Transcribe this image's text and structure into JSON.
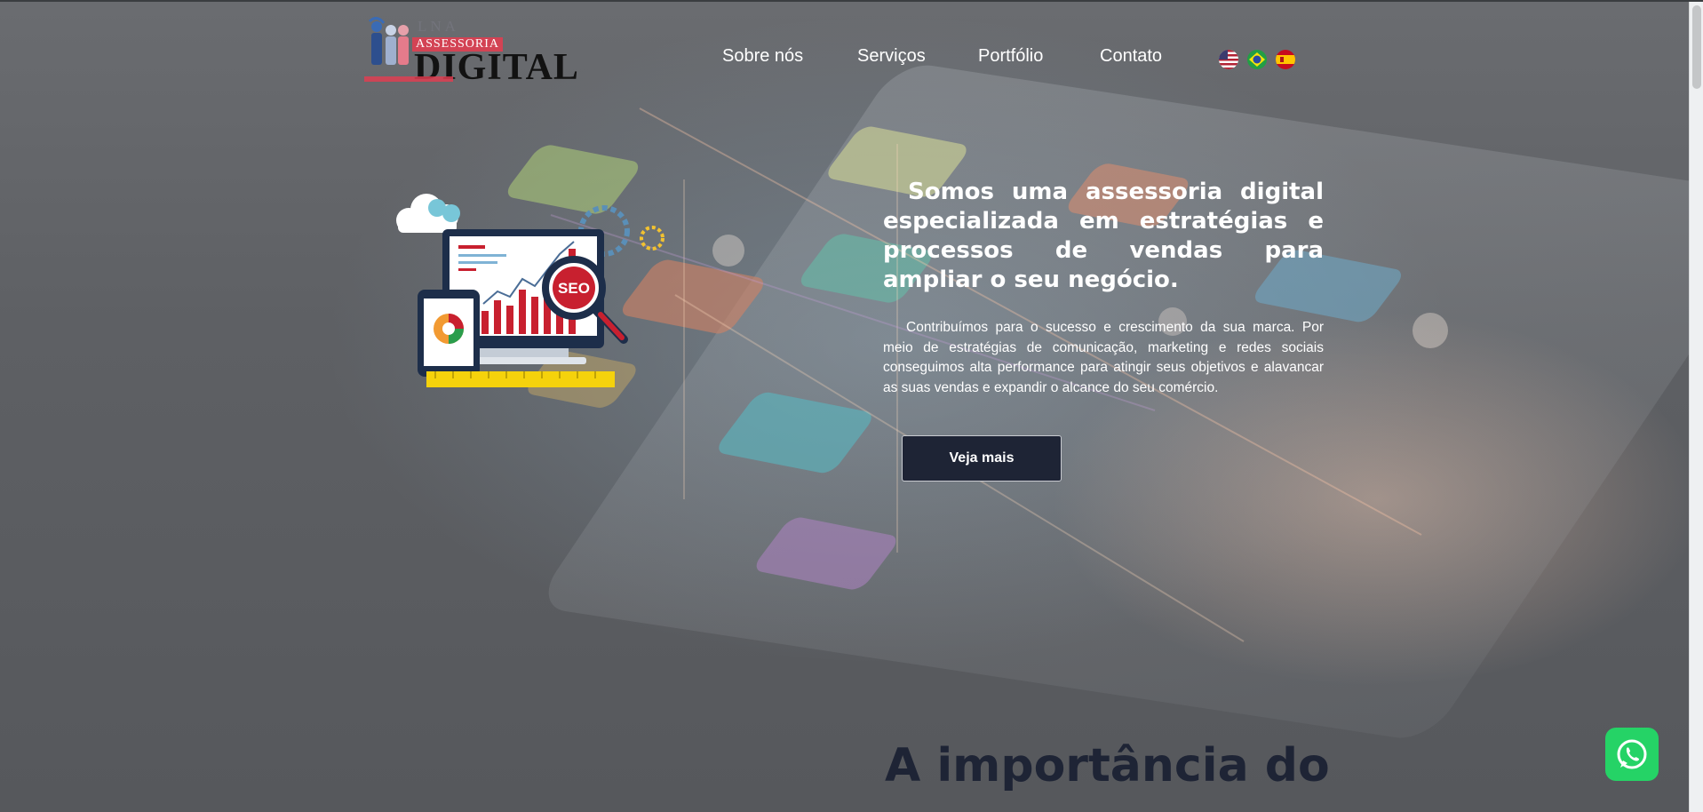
{
  "logo": {
    "top_text": "LNA",
    "middle_text": "ASSESSORIA",
    "main_text": "DIGITAL"
  },
  "nav": {
    "items": [
      {
        "label": "Sobre nós"
      },
      {
        "label": "Serviços"
      },
      {
        "label": "Portfólio"
      },
      {
        "label": "Contato"
      }
    ],
    "languages": [
      {
        "icon": "us-flag-icon"
      },
      {
        "icon": "brazil-flag-icon"
      },
      {
        "icon": "spain-flag-icon"
      }
    ]
  },
  "hero": {
    "illustration_badge": "SEO",
    "headline": "Somos uma assessoria digital especializada em estratégias e processos de vendas para ampliar o seu negócio.",
    "paragraph": "Contribuímos para o sucesso e crescimento da sua marca. Por meio de estratégias de comunicação, marketing e redes sociais conseguimos alta performance para atingir seus objetivos e alavancar as suas vendas e expandir o alcance do seu comércio.",
    "cta_label": "Veja mais"
  },
  "next_section": {
    "title": "A importância do"
  },
  "floating": {
    "whatsapp_icon": "whatsapp-icon"
  },
  "colors": {
    "accent_dark": "#1e2435",
    "whatsapp_green": "#25d366",
    "logo_red": "#e63c50"
  }
}
